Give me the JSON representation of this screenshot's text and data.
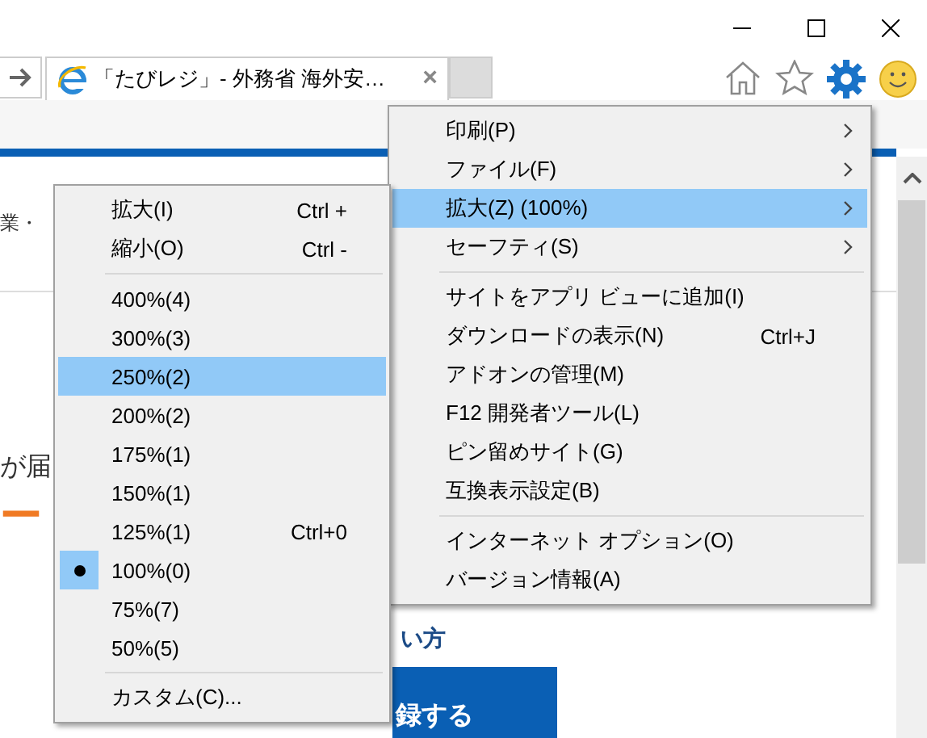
{
  "tab": {
    "title": "「たびレジ」- 外務省 海外安…",
    "close": "×"
  },
  "page": {
    "breadcrumb": "業・",
    "line_1": "が届",
    "heading": "ー",
    "link_text": "い方",
    "button": "録する"
  },
  "tools_menu": [
    {
      "kind": "item",
      "label": "印刷(P)",
      "submenu": true,
      "selected": false
    },
    {
      "kind": "item",
      "label": "ファイル(F)",
      "submenu": true,
      "selected": false
    },
    {
      "kind": "item",
      "label": "拡大(Z) (100%)",
      "submenu": true,
      "selected": true
    },
    {
      "kind": "item",
      "label": "セーフティ(S)",
      "submenu": true,
      "selected": false
    },
    {
      "kind": "separator"
    },
    {
      "kind": "item",
      "label": "サイトをアプリ ビューに追加(I)",
      "submenu": false,
      "selected": false
    },
    {
      "kind": "item",
      "label": "ダウンロードの表示(N)",
      "shortcut": "Ctrl+J",
      "submenu": false,
      "selected": false
    },
    {
      "kind": "item",
      "label": "アドオンの管理(M)",
      "submenu": false,
      "selected": false
    },
    {
      "kind": "item",
      "label": "F12 開発者ツール(L)",
      "submenu": false,
      "selected": false
    },
    {
      "kind": "item",
      "label": "ピン留めサイト(G)",
      "submenu": false,
      "selected": false
    },
    {
      "kind": "item",
      "label": "互換表示設定(B)",
      "submenu": false,
      "selected": false
    },
    {
      "kind": "separator"
    },
    {
      "kind": "item",
      "label": "インターネット オプション(O)",
      "submenu": false,
      "selected": false
    },
    {
      "kind": "item",
      "label": "バージョン情報(A)",
      "submenu": false,
      "selected": false
    }
  ],
  "zoom_menu": [
    {
      "kind": "item",
      "label": "拡大(I)",
      "shortcut": "Ctrl +",
      "selected": false
    },
    {
      "kind": "item",
      "label": "縮小(O)",
      "shortcut": "Ctrl -",
      "selected": false
    },
    {
      "kind": "separator"
    },
    {
      "kind": "radio",
      "label": "400%(4)",
      "selected": false,
      "checked": false
    },
    {
      "kind": "radio",
      "label": "300%(3)",
      "selected": false,
      "checked": false
    },
    {
      "kind": "radio",
      "label": "250%(2)",
      "selected": true,
      "checked": false
    },
    {
      "kind": "radio",
      "label": "200%(2)",
      "selected": false,
      "checked": false
    },
    {
      "kind": "radio",
      "label": "175%(1)",
      "selected": false,
      "checked": false
    },
    {
      "kind": "radio",
      "label": "150%(1)",
      "selected": false,
      "checked": false
    },
    {
      "kind": "radio",
      "label": "125%(1)",
      "shortcut": "Ctrl+0",
      "selected": false,
      "checked": false
    },
    {
      "kind": "radio",
      "label": "100%(0)",
      "selected": false,
      "checked": true
    },
    {
      "kind": "radio",
      "label": "75%(7)",
      "selected": false,
      "checked": false
    },
    {
      "kind": "radio",
      "label": "50%(5)",
      "selected": false,
      "checked": false
    },
    {
      "kind": "separator"
    },
    {
      "kind": "item",
      "label": "カスタム(C)...",
      "selected": false
    }
  ]
}
